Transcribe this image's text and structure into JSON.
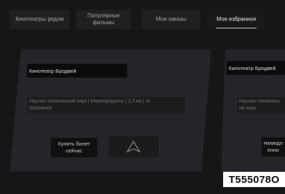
{
  "tabs": [
    {
      "label": "Кинотеатры рядом"
    },
    {
      "label": "Популярные\nфильмы"
    },
    {
      "label": "Мои заказы"
    },
    {
      "label": "Мое избранное"
    }
  ],
  "active_tab_index": 3,
  "cards": [
    {
      "name": "Кинотеатр Бродвей",
      "description": "Научно-технический  парк  | Морепродукты | 2,3  км  | от\n300юаней",
      "buy_label": "Купить билет\nсейчас",
      "nav_icon": "navigate-arrow-icon"
    },
    {
      "name": "Кинотеатр Бродвей",
      "description": "Научно-техническ\nий парк",
      "buy_label": "Немедл\nенно"
    }
  ],
  "code_badge": "T555078O",
  "colors": {
    "background": "#151617",
    "card": "#242528",
    "tab": "#1f2022",
    "badge": "#ffffff"
  }
}
